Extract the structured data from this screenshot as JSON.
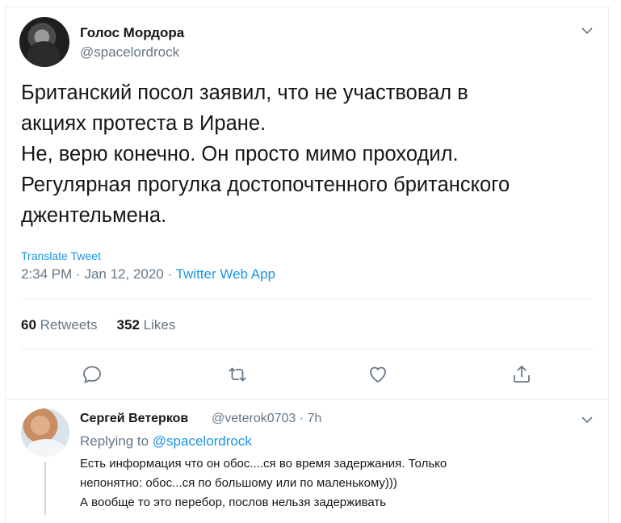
{
  "tweet": {
    "author_name": "Голос Мордора",
    "author_handle": "@spacelordrock",
    "text_lines": [
      "Британский посол заявил, что не участвовал в",
      "акциях протеста в Иране.",
      "Не, верю конечно. Он просто мимо проходил.",
      "Регулярная прогулка достопочтенного британского",
      "джентельмена."
    ],
    "translate_label": "Translate Tweet",
    "time": "2:34 PM",
    "date": "Jan 12, 2020",
    "source": "Twitter Web App",
    "retweets_count": "60",
    "retweets_label": "Retweets",
    "likes_count": "352",
    "likes_label": "Likes"
  },
  "actions": {
    "icons": [
      "reply-icon",
      "retweet-icon",
      "like-icon",
      "share-icon"
    ]
  },
  "reply": {
    "author_name": "Сергей Ветерков",
    "author_handle": "@veterok0703",
    "age": "7h",
    "replying_prefix": "Replying to",
    "replying_to": "@spacelordrock",
    "text_lines": [
      "Есть информация что он обос....ся во время задержания. Только",
      "непонятно: обос...ся по большому  или по маленькому)))",
      "А вообще то это перебор, послов нельзя задерживать"
    ]
  },
  "colors": {
    "text": "#14171a",
    "secondary": "#657786",
    "link": "#1b95e0",
    "border": "#e6ecf0"
  }
}
